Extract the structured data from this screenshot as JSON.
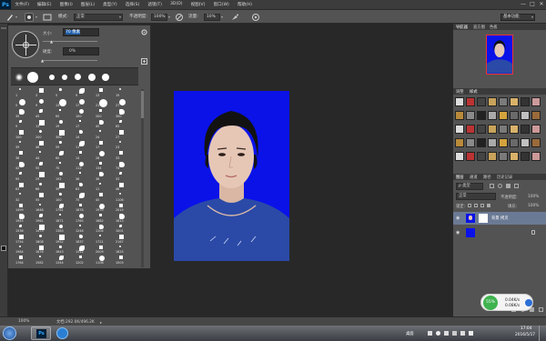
{
  "menubar": {
    "logo": "Ps",
    "items": [
      "文件(F)",
      "编辑(E)",
      "图像(I)",
      "图层(L)",
      "类型(Y)",
      "选择(S)",
      "滤镜(T)",
      "3D(D)",
      "视图(V)",
      "窗口(W)",
      "帮助(H)"
    ],
    "minimize": "—",
    "maximize": "□",
    "close": "✕"
  },
  "options": {
    "mode_label": "模式:",
    "mode_value": "正常",
    "opacity_label": "不透明度:",
    "opacity_value": "100%",
    "flow_label": "流量:",
    "flow_value": "10%",
    "workspace": "基本功能"
  },
  "brush_panel": {
    "size_label": "大小:",
    "size_value": "70 像素",
    "hardness_label": "硬度:",
    "hardness_value": "0%",
    "numbers": [
      [
        "1",
        "3",
        "5",
        "9",
        "13",
        "19"
      ],
      [
        "5",
        "9",
        "13",
        "17",
        "21",
        "27"
      ],
      [
        "35",
        "45",
        "65",
        "100",
        "200",
        "300"
      ],
      [
        "9",
        "13",
        "19",
        "17",
        "45",
        "65"
      ],
      [
        "100",
        "200",
        "300",
        "14",
        "24",
        "27"
      ],
      [
        "39",
        "46",
        "59",
        "11",
        "17",
        "23"
      ],
      [
        "36",
        "44",
        "60",
        "14",
        "26",
        "33"
      ],
      [
        "42",
        "55",
        "70",
        "112",
        "134",
        "74"
      ],
      [
        "95",
        "29",
        "192",
        "36",
        "36",
        "33"
      ],
      [
        "63",
        "66",
        "39",
        "63",
        "11",
        "48"
      ],
      [
        "32",
        "55",
        "100",
        "75",
        "45",
        "1106"
      ],
      [
        "1499",
        "1648",
        "1761",
        "1876",
        "1970",
        "2015"
      ],
      [
        "1945",
        "1961",
        "1871",
        "1765",
        "1682",
        "1613"
      ],
      [
        "1536",
        "1473",
        "1383",
        "1246",
        "1104",
        "1001"
      ],
      [
        "1754",
        "1808",
        "1952",
        "1837",
        "1721",
        "2167"
      ],
      [
        "1984",
        "1876",
        "1643",
        "1512",
        "2009",
        "1825"
      ],
      [
        "1764",
        "1582",
        "1344",
        "1202",
        "1108",
        "1003"
      ]
    ]
  },
  "right_panel": {
    "top_tabs": [
      "导航器",
      "直方图",
      "色板"
    ],
    "style_tabs": [
      "调整",
      "样式"
    ],
    "layer_tabs": [
      "图层",
      "通道",
      "路径",
      "历史记录"
    ],
    "kind_label": "类型",
    "blend_mode": "正常",
    "opacity_label": "不透明度:",
    "opacity_value": "100%",
    "lock_label": "锁定:",
    "fill_label": "填充:",
    "fill_value": "100%",
    "layers": [
      {
        "name": "背景 拷贝"
      },
      {
        "name": ""
      }
    ]
  },
  "status": {
    "zoom": "100%",
    "doc": "文档:292.0K/496.2K"
  },
  "taskbar": {
    "ps_label": "Ps",
    "desktop_label": "桌面",
    "time": "17:04",
    "date": "2016/5/17",
    "net_percent": "55%",
    "net_up": "0.04K/s",
    "net_down": "0.08K/s"
  },
  "colors": {
    "photo_bg": "#0a12e8",
    "accent": "#31a8ff",
    "net_widget": "#3fb34f"
  }
}
